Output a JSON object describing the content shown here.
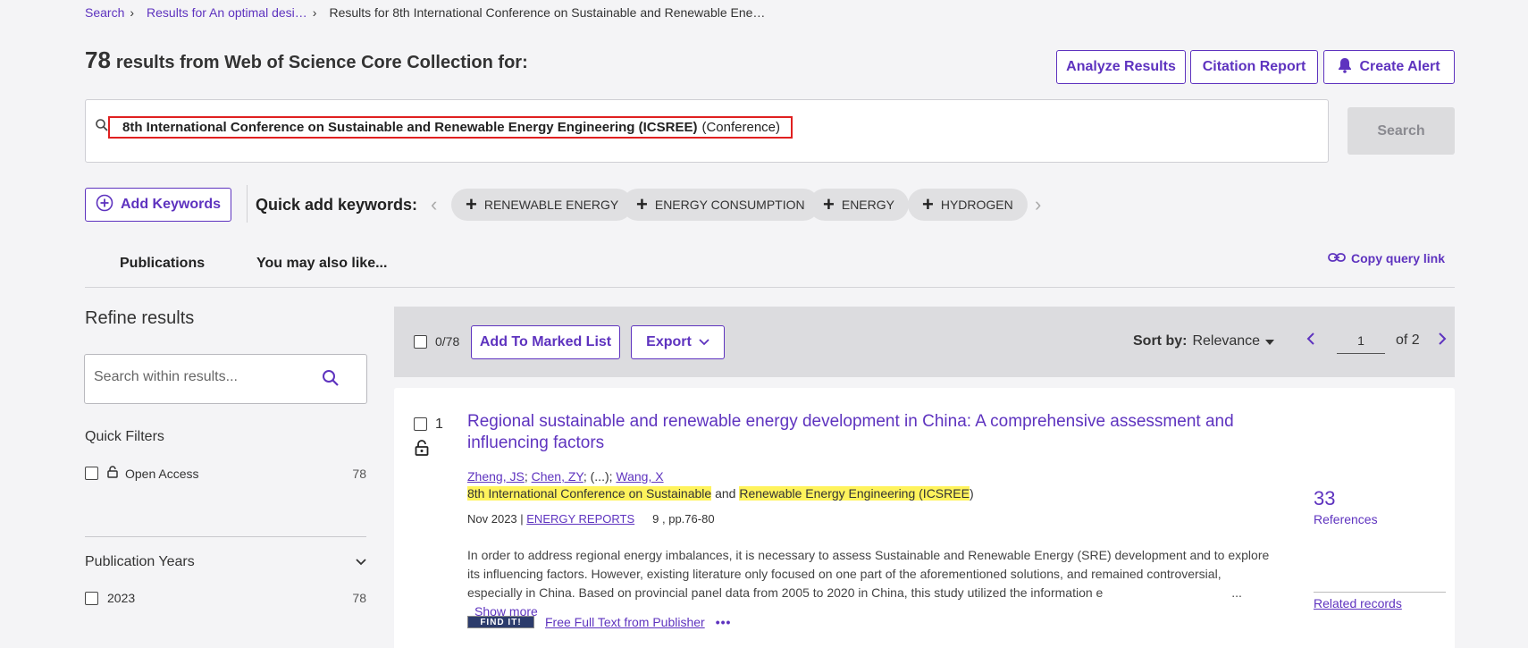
{
  "breadcrumb": {
    "items": [
      "Search",
      "Results for An optimal desi…",
      "Results for 8th International Conference on Sustainable and Renewable Ene…"
    ]
  },
  "results": {
    "count": "78",
    "label": "results from Web of Science Core Collection for:"
  },
  "actions": {
    "analyze": "Analyze Results",
    "citation": "Citation Report",
    "alert": "Create Alert"
  },
  "search": {
    "query_bold": "8th International Conference on Sustainable and Renewable Energy Engineering (ICSREE)",
    "query_type": "(Conference)",
    "button": "Search"
  },
  "keywords": {
    "add_label": "Add Keywords",
    "quick_label": "Quick add keywords:",
    "chips": [
      "RENEWABLE ENERGY",
      "ENERGY CONSUMPTION",
      "ENERGY",
      "HYDROGEN"
    ]
  },
  "tabs": {
    "publications": "Publications",
    "also_like": "You may also like...",
    "copy_link": "Copy query link"
  },
  "refine": {
    "title": "Refine results",
    "search_placeholder": "Search within results...",
    "quick_filters": "Quick Filters",
    "open_access": "Open Access",
    "open_access_count": "78",
    "pub_years": "Publication Years",
    "year": "2023",
    "year_count": "78"
  },
  "toolbar": {
    "selected": "0/78",
    "add_marked": "Add To Marked List",
    "export": "Export",
    "sort_prefix": "Sort by:",
    "sort_value": "Relevance",
    "page": "1",
    "of": "of 2"
  },
  "record": {
    "index": "1",
    "title": "Regional sustainable and renewable energy development in China: A comprehensive assessment and influencing factors",
    "author1": "Zheng, JS",
    "author2": "Chen, ZY",
    "author_mid": "; (...); ",
    "author3": "Wang, X",
    "conf_hl1": "8th International Conference on Sustainable",
    "conf_and": " and ",
    "conf_hl2": "Renewable Energy Engineering (ICSREE",
    "conf_end": ")",
    "date": "Nov 2023 | ",
    "journal": "ENERGY REPORTS",
    "volume": "9 , pp.76-80",
    "abstract": "In order to address regional energy imbalances, it is necessary to assess Sustainable and Renewable Energy (SRE) development and to explore its influencing factors. However, existing literature only focused on one part of the aforementioned solutions, and remained controversial, especially in China. Based on provincial panel data from 2005 to 2020 in China, this study utilized the information e",
    "ellipsis": "...",
    "show_more": "Show more",
    "find_it": "FIND IT!",
    "full_text": "Free Full Text from Publisher",
    "more": "•••",
    "ref_count": "33",
    "ref_label": "References",
    "related": "Related records"
  },
  "colors": {
    "accent": "#5e33bf",
    "highlight": "#fff35c",
    "query_border": "#e02020"
  }
}
